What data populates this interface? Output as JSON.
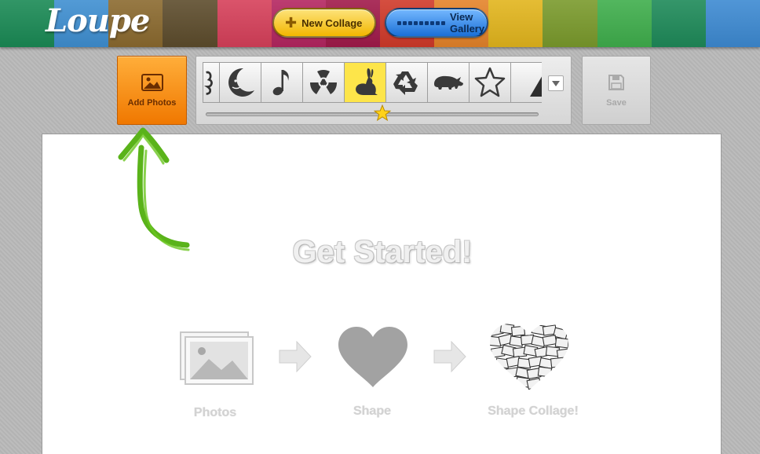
{
  "header": {
    "logo_text": "Loupe",
    "stripe_colors": [
      "#1a8a55",
      "#3f8fd1",
      "#8b6a2f",
      "#5d4c2c",
      "#d6405a",
      "#b42660",
      "#a11a4a",
      "#d03a2a",
      "#e4832a",
      "#e2b51d",
      "#7a9a2c",
      "#3fae4c",
      "#1e8a59",
      "#3d8ad2"
    ],
    "new_collage_label": "New Collage",
    "view_gallery_label": "View Gallery"
  },
  "toolbar": {
    "add_photos_label": "Add Photos",
    "save_label": "Save",
    "shapes": [
      {
        "name": "woman-silhouette-icon",
        "active": false
      },
      {
        "name": "moon-face-icon",
        "active": false
      },
      {
        "name": "music-note-icon",
        "active": false
      },
      {
        "name": "radiation-icon",
        "active": false
      },
      {
        "name": "rabbit-icon",
        "active": true
      },
      {
        "name": "recycle-icon",
        "active": false
      },
      {
        "name": "rhino-icon",
        "active": false
      },
      {
        "name": "star-outline-icon",
        "active": false
      },
      {
        "name": "triangle-icon",
        "active": false
      }
    ]
  },
  "canvas": {
    "title": "Get Started!",
    "steps": [
      {
        "label": "Photos",
        "icon": "photos-icon"
      },
      {
        "label": "Shape",
        "icon": "heart-icon"
      },
      {
        "label": "Shape Collage!",
        "icon": "heart-collage-icon"
      }
    ]
  },
  "colors": {
    "accent_orange": "#f28a12",
    "hand_arrow_green": "#5ab31a",
    "active_shape_yellow": "#fde54a"
  }
}
